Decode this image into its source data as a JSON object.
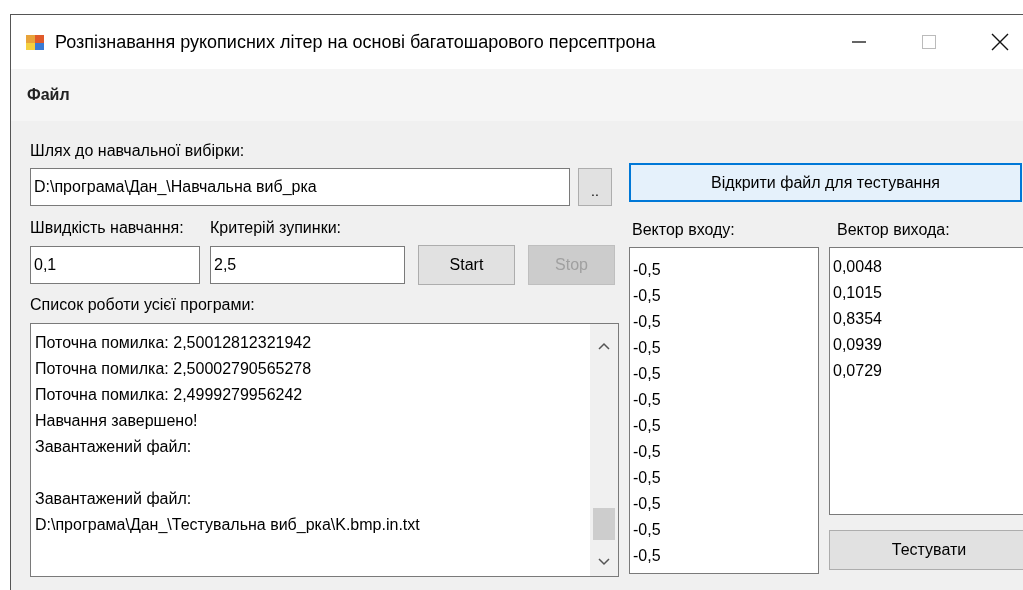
{
  "window": {
    "title": "Розпізнавання рукописних літер на основі багатошарового персептрона"
  },
  "menu": [
    "Файл"
  ],
  "training_path": {
    "label": "Шлях до навчальної вибірки:",
    "value": "D:\\програма\\Дан_\\Навчальна виб_рка",
    "browse_button": ".."
  },
  "learning_rate": {
    "label": "Швидкість навчання:",
    "value": "0,1"
  },
  "stop_criterion": {
    "label": "Критерій зупинки:",
    "value": "2,5"
  },
  "buttons": [
    {
      "label": "Start",
      "disabled": false
    },
    {
      "label": "Stop",
      "disabled": true
    }
  ],
  "log": {
    "label": "Список роботи усієї програми:",
    "blocks": [
      {
        "lines": [
          "Поточна помилка: 2,50012812321942",
          "Поточна помилка: 2,50002790565278",
          "Поточна помилка: 2,4999279956242",
          "Навчання завершено!",
          "Завантажений файл:"
        ]
      },
      {
        "lines": [
          "Завантажений файл:",
          "D:\\програма\\Дан_\\Тестувальна виб_рка\\K.bmp.in.txt"
        ]
      }
    ]
  },
  "open_test_button": {
    "label": "Відкрити файл для тестування",
    "focused": true
  },
  "input_vector": {
    "label": "Вектор входу:",
    "values": [
      "-0,5",
      "-0,5",
      "-0,5",
      "-0,5",
      "-0,5",
      "-0,5",
      "-0,5",
      "-0,5",
      "-0,5",
      "-0,5",
      "-0,5",
      "-0,5"
    ]
  },
  "output_vector": {
    "label": "Вектор вихода:",
    "values": [
      "0,0048",
      "0,1015",
      "0,8354",
      "0,0939",
      "0,0729"
    ]
  },
  "test_button": {
    "label": "Тестувати",
    "disabled": false
  }
}
